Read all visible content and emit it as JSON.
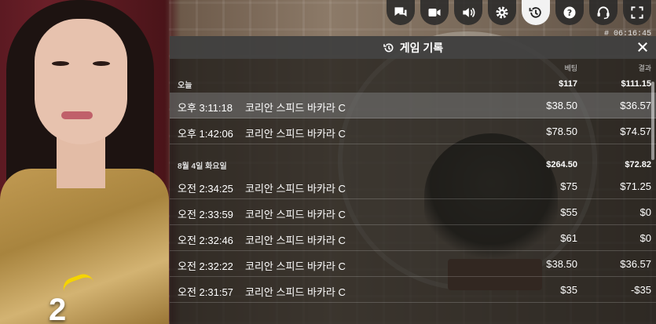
{
  "round": {
    "number": "2"
  },
  "toolbar": {
    "buttons": [
      {
        "icon": "chat-icon"
      },
      {
        "icon": "video-icon"
      },
      {
        "icon": "volume-icon"
      },
      {
        "icon": "gear-icon"
      },
      {
        "icon": "history-icon",
        "active": true
      },
      {
        "icon": "help-icon"
      },
      {
        "icon": "headset-icon"
      },
      {
        "icon": "fullscreen-icon"
      }
    ],
    "timestamp": "# 06:16:45"
  },
  "history": {
    "title": "게임 기록",
    "columns": {
      "bet": "베팅",
      "result": "결과"
    },
    "days": [
      {
        "label": "오늘",
        "bet_total": "$117",
        "result_total": "$111.15",
        "rows": [
          {
            "time": "오후 3:11:18",
            "game": "코리안 스피드 바카라 C",
            "bet": "$38.50",
            "result": "$36.57",
            "highlighted": true
          },
          {
            "time": "오후 1:42:06",
            "game": "코리안 스피드 바카라 C",
            "bet": "$78.50",
            "result": "$74.57"
          }
        ]
      },
      {
        "label": "8월 4일 화요일",
        "bet_total": "$264.50",
        "result_total": "$72.82",
        "rows": [
          {
            "time": "오전 2:34:25",
            "game": "코리안 스피드 바카라 C",
            "bet": "$75",
            "result": "$71.25"
          },
          {
            "time": "오전 2:33:59",
            "game": "코리안 스피드 바카라 C",
            "bet": "$55",
            "result": "$0"
          },
          {
            "time": "오전 2:32:46",
            "game": "코리안 스피드 바카라 C",
            "bet": "$61",
            "result": "$0"
          },
          {
            "time": "오전 2:32:22",
            "game": "코리안 스피드 바카라 C",
            "bet": "$38.50",
            "result": "$36.57"
          },
          {
            "time": "오전 2:31:57",
            "game": "코리안 스피드 바카라 C",
            "bet": "$35",
            "result": "-$35"
          }
        ]
      }
    ]
  }
}
